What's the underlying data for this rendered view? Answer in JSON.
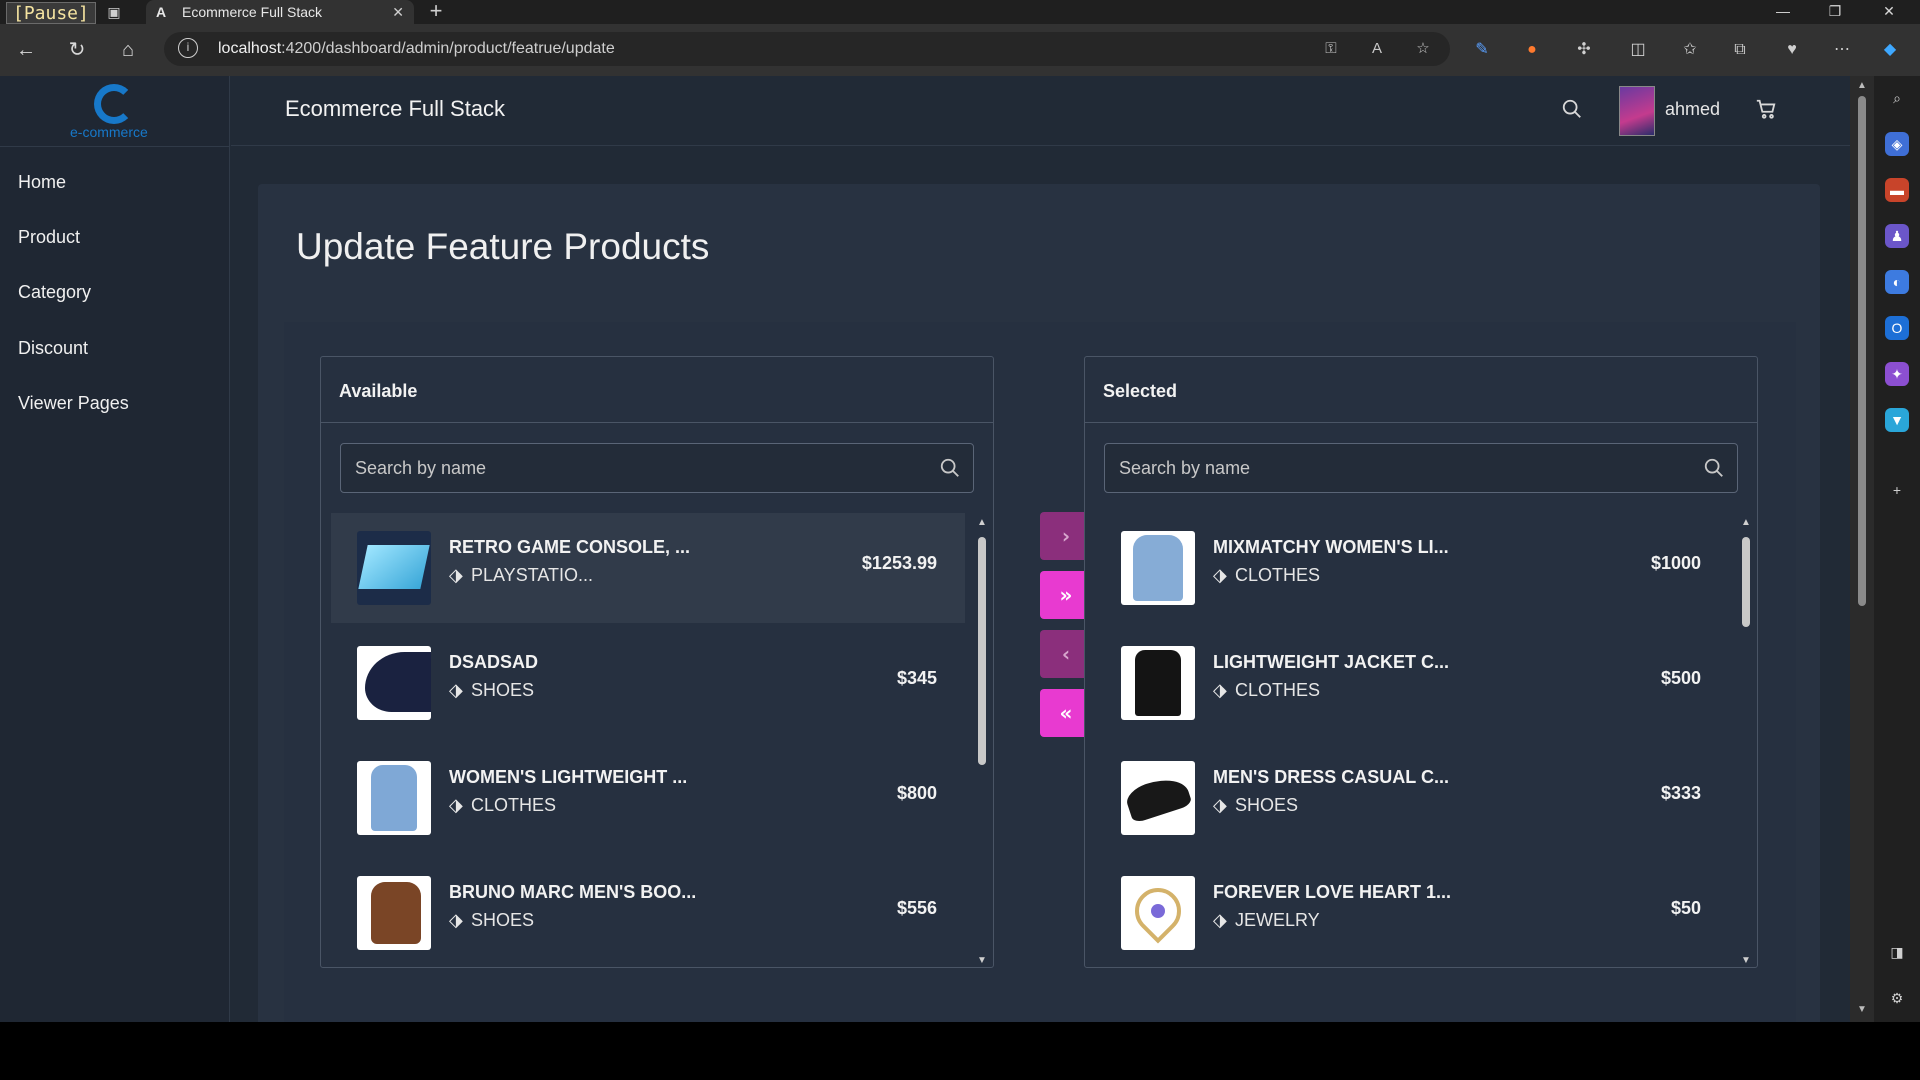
{
  "browser": {
    "pause_label": "[Pause]",
    "tab_title": "Ecommerce Full Stack",
    "tab_favicon": "A",
    "url_host": "localhost",
    "url_path": ":4200/dashboard/admin/product/featrue/update"
  },
  "app": {
    "logo_text": "e-commerce",
    "title": "Ecommerce Full Stack",
    "username": "ahmed"
  },
  "sidebar": {
    "items": [
      {
        "label": "Home"
      },
      {
        "label": "Product"
      },
      {
        "label": "Category"
      },
      {
        "label": "Discount"
      },
      {
        "label": "Viewer Pages"
      }
    ]
  },
  "main": {
    "page_title": "Update Feature Products",
    "available": {
      "header": "Available",
      "search_placeholder": "Search by name",
      "items": [
        {
          "name": "RETRO GAME CONSOLE, ...",
          "category": "PLAYSTATIO...",
          "price": "$1253.99"
        },
        {
          "name": "DSADSAD",
          "category": "SHOES",
          "price": "$345"
        },
        {
          "name": "WOMEN'S LIGHTWEIGHT ...",
          "category": "CLOTHES",
          "price": "$800"
        },
        {
          "name": "BRUNO MARC MEN'S BOO...",
          "category": "SHOES",
          "price": "$556"
        }
      ]
    },
    "selected": {
      "header": "Selected",
      "search_placeholder": "Search by name",
      "items": [
        {
          "name": "MIXMATCHY WOMEN'S LI...",
          "category": "CLOTHES",
          "price": "$1000"
        },
        {
          "name": "LIGHTWEIGHT JACKET C...",
          "category": "CLOTHES",
          "price": "$500"
        },
        {
          "name": "MEN'S DRESS CASUAL C...",
          "category": "SHOES",
          "price": "$333"
        },
        {
          "name": "FOREVER LOVE HEART 1...",
          "category": "JEWELRY",
          "price": "$50"
        }
      ]
    },
    "transfer_buttons": {
      "move_right": "›",
      "move_all_right": "»",
      "move_left": "‹",
      "move_all_left": "«"
    }
  },
  "colors": {
    "accent": "#e83ad0",
    "accent_dim": "#8b2f7c",
    "page_bg": "#212a36",
    "card_bg": "#283241",
    "logo": "#1778c9"
  }
}
